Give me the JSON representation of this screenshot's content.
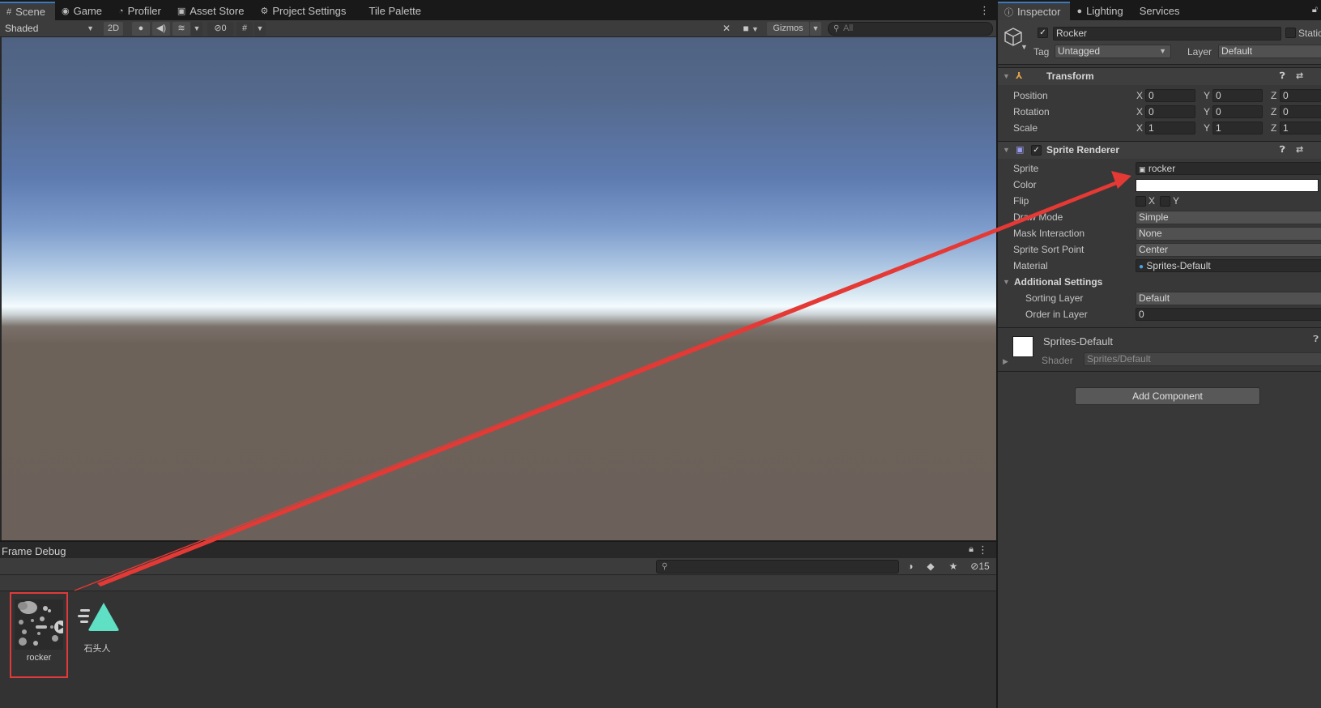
{
  "scene_window": {
    "tabs": [
      {
        "label": "Scene",
        "icon": "grid-icon",
        "active": true
      },
      {
        "label": "Game",
        "icon": "gamepad-icon"
      },
      {
        "label": "Profiler",
        "icon": "stopwatch-icon"
      },
      {
        "label": "Asset Store",
        "icon": "bag-icon"
      },
      {
        "label": "Project Settings",
        "icon": "gear-icon"
      },
      {
        "label": "Tile Palette",
        "icon": ""
      }
    ],
    "toolbar": {
      "shading_mode": "Shaded",
      "mode_2d": "2D",
      "hidden_count": "0",
      "gizmos_label": "Gizmos",
      "search_placeholder": "All"
    }
  },
  "frame_debug": {
    "title": "Frame Debug"
  },
  "project": {
    "hidden_count": "15",
    "assets": [
      {
        "name": "rocker",
        "icon": "sprite-sheet-icon",
        "selected": true
      },
      {
        "name": "石头人",
        "icon": "animation-controller-icon",
        "selected": false
      }
    ]
  },
  "inspector": {
    "tabs": [
      {
        "label": "Inspector",
        "icon": "info-icon",
        "active": true
      },
      {
        "label": "Lighting",
        "icon": "bulb-icon"
      },
      {
        "label": "Services",
        "icon": ""
      }
    ],
    "object": {
      "name": "Rocker",
      "active": true,
      "static_label": "Static",
      "tag_label": "Tag",
      "tag_value": "Untagged",
      "layer_label": "Layer",
      "layer_value": "Default"
    },
    "transform": {
      "title": "Transform",
      "rows": [
        {
          "label": "Position",
          "x": "0",
          "y": "0",
          "z": "0"
        },
        {
          "label": "Rotation",
          "x": "0",
          "y": "0",
          "z": "0"
        },
        {
          "label": "Scale",
          "x": "1",
          "y": "1",
          "z": "1"
        }
      ]
    },
    "sprite_renderer": {
      "title": "Sprite Renderer",
      "enabled": true,
      "sprite_label": "Sprite",
      "sprite_value": "rocker",
      "color_label": "Color",
      "color_value": "#ffffff",
      "flip_label": "Flip",
      "flip_x": "X",
      "flip_y": "Y",
      "draw_mode_label": "Draw Mode",
      "draw_mode_value": "Simple",
      "mask_label": "Mask Interaction",
      "mask_value": "None",
      "sort_point_label": "Sprite Sort Point",
      "sort_point_value": "Center",
      "material_label": "Material",
      "material_value": "Sprites-Default",
      "additional_label": "Additional Settings",
      "sorting_layer_label": "Sorting Layer",
      "sorting_layer_value": "Default",
      "order_label": "Order in Layer",
      "order_value": "0"
    },
    "material_preview": {
      "name": "Sprites-Default",
      "shader_label": "Shader",
      "shader_value": "Sprites/Default"
    },
    "add_component_label": "Add Component"
  },
  "annotation": {
    "color": "#e53935",
    "from": "rocker asset",
    "to": "Sprite field"
  },
  "colors": {
    "accent": "#3a79bb",
    "panel": "#383838",
    "header": "#3c3c3c"
  }
}
